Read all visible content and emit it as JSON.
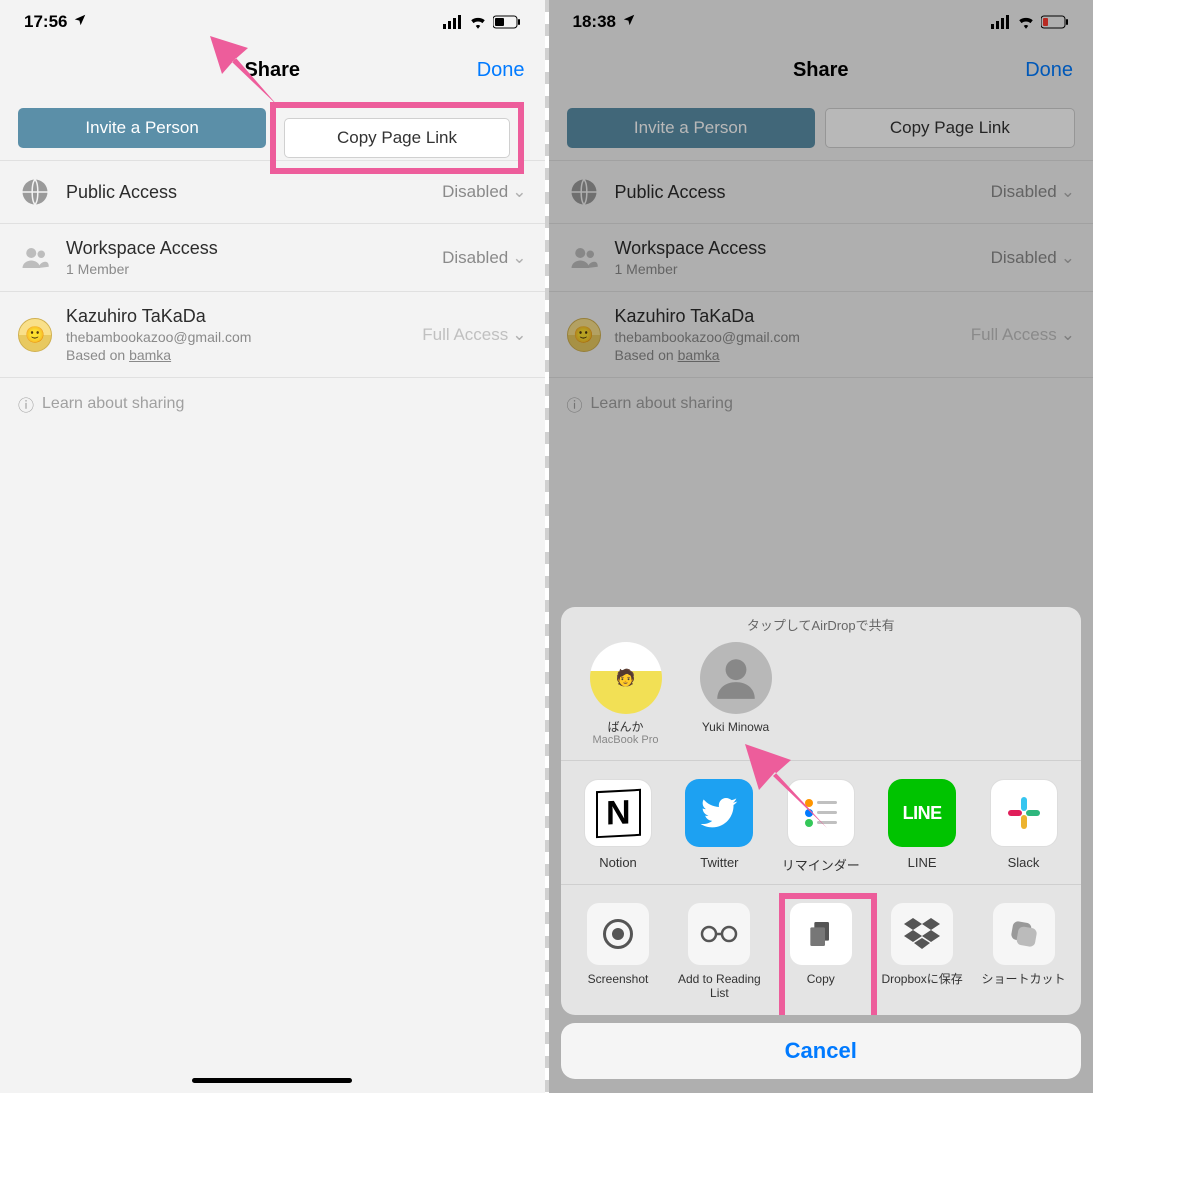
{
  "left": {
    "time": "17:56",
    "nav_title": "Share",
    "nav_done": "Done",
    "invite_btn": "Invite a Person",
    "copy_btn": "Copy Page Link",
    "rows": {
      "public": {
        "title": "Public Access",
        "value": "Disabled"
      },
      "workspace": {
        "title": "Workspace Access",
        "sub": "1 Member",
        "value": "Disabled"
      },
      "user": {
        "title": "Kazuhiro TaKaDa",
        "email": "thebambookazoo@gmail.com",
        "based_prefix": "Based on ",
        "based_link": "bamka",
        "value": "Full Access"
      }
    },
    "learn": "Learn about sharing"
  },
  "right": {
    "time": "18:38",
    "nav_title": "Share",
    "nav_done": "Done",
    "invite_btn": "Invite a Person",
    "copy_btn": "Copy Page Link",
    "rows": {
      "public": {
        "title": "Public Access",
        "value": "Disabled"
      },
      "workspace": {
        "title": "Workspace Access",
        "sub": "1 Member",
        "value": "Disabled"
      },
      "user": {
        "title": "Kazuhiro TaKaDa",
        "email": "thebambookazoo@gmail.com",
        "based_prefix": "Based on ",
        "based_link": "bamka",
        "value": "Full Access"
      }
    },
    "learn": "Learn about sharing",
    "sheet": {
      "airdrop_header": "タップしてAirDropで共有",
      "airdrop": [
        {
          "name": "ばんか",
          "sub": "MacBook Pro"
        },
        {
          "name": "Yuki Minowa",
          "sub": ""
        }
      ],
      "apps": [
        {
          "label": "Notion"
        },
        {
          "label": "Twitter"
        },
        {
          "label": "リマインダー"
        },
        {
          "label": "LINE"
        },
        {
          "label": "Slack"
        }
      ],
      "actions": [
        {
          "label": "Screenshot"
        },
        {
          "label": "Add to Reading List"
        },
        {
          "label": "Copy"
        },
        {
          "label": "Dropboxに保存"
        },
        {
          "label": "ショートカット"
        }
      ],
      "cancel": "Cancel"
    }
  }
}
